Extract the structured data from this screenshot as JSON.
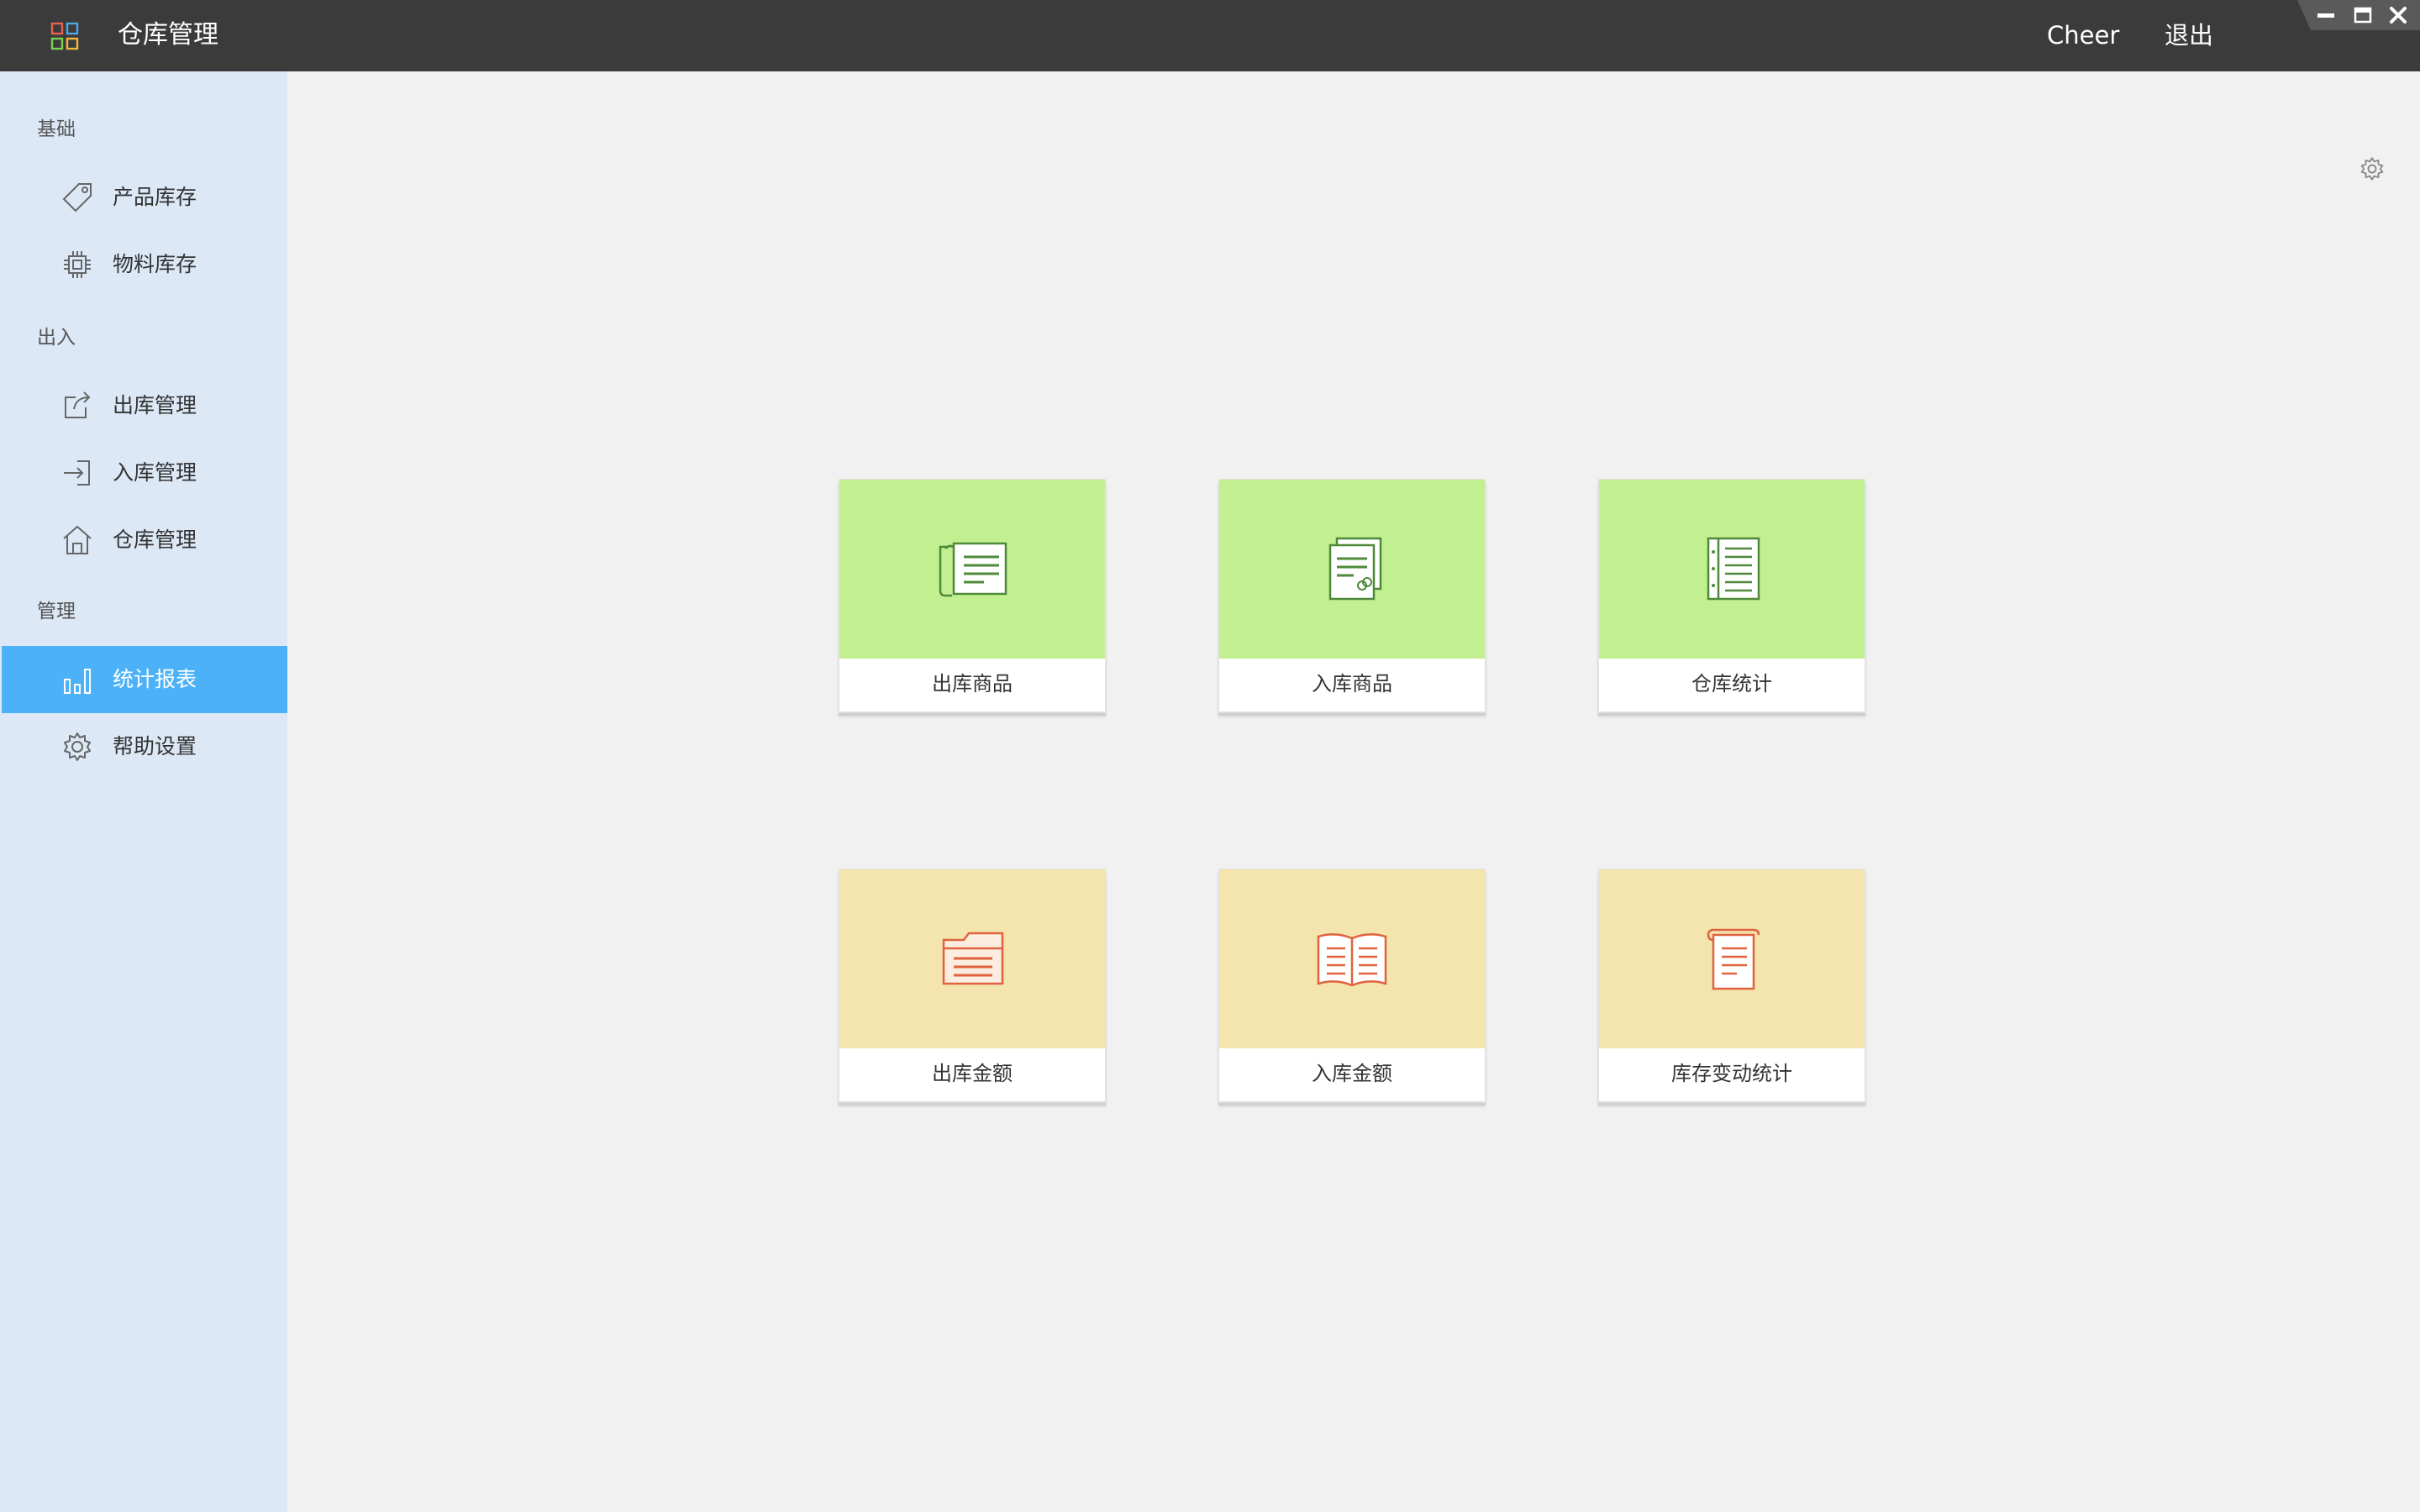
{
  "app": {
    "title": "仓库管理",
    "logo_icon": "grid-logo-icon"
  },
  "header": {
    "user": "Cheer",
    "logout_label": "退出"
  },
  "window_controls": [
    "minimize-icon",
    "maximize-icon",
    "close-icon"
  ],
  "sidebar": {
    "sections": [
      {
        "title": "基础",
        "items": [
          {
            "label": "产品库存",
            "icon": "tag-icon"
          },
          {
            "label": "物料库存",
            "icon": "chip-icon"
          }
        ]
      },
      {
        "title": "出入",
        "items": [
          {
            "label": "出库管理",
            "icon": "export-icon"
          },
          {
            "label": "入库管理",
            "icon": "import-icon"
          },
          {
            "label": "仓库管理",
            "icon": "home-icon"
          }
        ]
      },
      {
        "title": "管理",
        "items": [
          {
            "label": "统计报表",
            "icon": "bar-chart-icon",
            "active": true
          },
          {
            "label": "帮助设置",
            "icon": "settings-icon"
          }
        ]
      }
    ]
  },
  "tiles": [
    {
      "label": "出库商品",
      "color": "#c2ef8f",
      "icon": "scroll-list-icon"
    },
    {
      "label": "入库商品",
      "color": "#c2ef8f",
      "icon": "documents-link-icon"
    },
    {
      "label": "仓库统计",
      "color": "#c2ef8f",
      "icon": "notebook-icon"
    },
    {
      "label": "出库金额",
      "color": "#f4e4ad",
      "icon": "folder-icon"
    },
    {
      "label": "入库金额",
      "color": "#f4e4ad",
      "icon": "open-book-icon"
    },
    {
      "label": "库存变动统计",
      "color": "#f4e4ad",
      "icon": "scroll-doc-icon"
    }
  ],
  "colors": {
    "titlebar": "#3b3b3b",
    "sidebar": "#dde8f6",
    "active": "#4cb1f6",
    "green_tile": "#c2ef8f",
    "yellow_tile": "#f4e4ad"
  }
}
